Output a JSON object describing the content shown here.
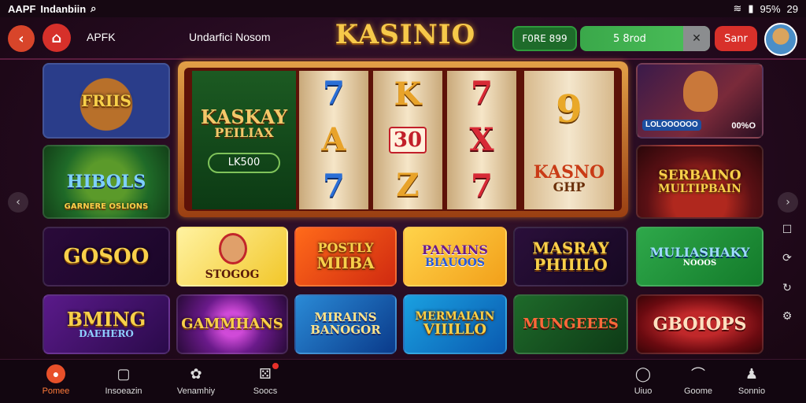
{
  "status_bar": {
    "app_name": "AAPF",
    "location": "Indanbiin",
    "time": "29",
    "battery": "95%"
  },
  "header": {
    "app_label": "APFK",
    "nav_label": "Undarfici Nosom",
    "logo": "KASINIO",
    "balance": "F0RE 899",
    "deposit": "5 8rod",
    "start_label": "Sanr"
  },
  "tiles": {
    "roulette": {
      "title": "FRIIS"
    },
    "boss": {
      "title": "HIBOLS",
      "caption": "GARNERE OSLIONS"
    },
    "slot": {
      "title": "KASKAY",
      "subtitle": "PEILIAX",
      "amount": "LK500",
      "reel1": [
        "7",
        "A",
        "7"
      ],
      "reel2": [
        "K",
        "30",
        "Z"
      ],
      "reel3": [
        "7",
        "X",
        "7"
      ],
      "right_symbol": "9",
      "right_brand": "KASNO",
      "right_sub": "GHP"
    },
    "fox": {
      "badge": "LOLOOOOOO",
      "value": "00%O"
    },
    "multiplayer": {
      "title": "SERBAINO",
      "subtitle": "MULTIPBAIN"
    },
    "row3": [
      {
        "title": "GOSOO",
        "caption": ""
      },
      {
        "title": "",
        "caption": "STOGOG"
      },
      {
        "title": "POSTLY",
        "caption": "MIIBA"
      },
      {
        "title": "PANAINS",
        "caption": "BIAUOOS"
      },
      {
        "title": "MASRAY",
        "caption": "PHIIILO"
      },
      {
        "title": "MULIASHAKY",
        "caption": "NOOOS"
      }
    ],
    "row4": [
      {
        "title": "BMING",
        "caption": "DAEHERO"
      },
      {
        "title": "GAMMHANS",
        "caption": ""
      },
      {
        "title": "MIRAINS",
        "caption": "BANOGOR"
      },
      {
        "title": "MERMAIAIN",
        "caption": "VIIILLO"
      },
      {
        "title": "MUNGEEES",
        "caption": ""
      },
      {
        "title": "GBOIOPS",
        "caption": ""
      }
    ]
  },
  "bottom_nav": [
    {
      "label": "Pomee",
      "icon": "home-icon"
    },
    {
      "label": "Insoeazin",
      "icon": "square-icon"
    },
    {
      "label": "Venamhiy",
      "icon": "gear-icon"
    },
    {
      "label": "Soocs",
      "icon": "dice-icon"
    },
    {
      "label": "Uiuo",
      "icon": "chat-icon"
    },
    {
      "label": "Goome",
      "icon": "headset-icon"
    },
    {
      "label": "Sonnio",
      "icon": "profile-icon"
    }
  ]
}
